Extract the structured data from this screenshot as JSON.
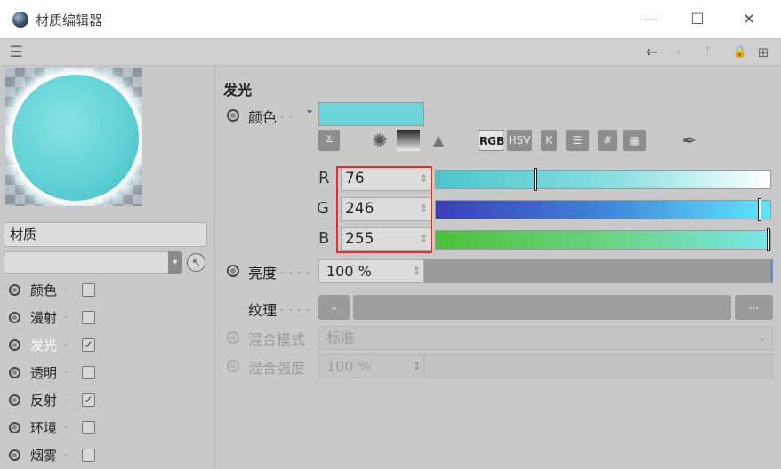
{
  "window": {
    "title": "材质编辑器",
    "controls": {
      "minimize": "—",
      "maximize": "☐",
      "close": "✕"
    }
  },
  "toolbar": {
    "menu_icon": "☰",
    "back_icon": "←",
    "forward_icon": "→",
    "up_icon": "↑",
    "lock_icon": "🔒",
    "new_icon": "⊞"
  },
  "left": {
    "material_name": "材质",
    "channels": [
      {
        "label": "颜色",
        "checked": false
      },
      {
        "label": "漫射",
        "checked": false
      },
      {
        "label": "发光",
        "checked": true
      },
      {
        "label": "透明",
        "checked": false
      },
      {
        "label": "反射",
        "checked": true
      },
      {
        "label": "环境",
        "checked": false
      },
      {
        "label": "烟雾",
        "checked": false
      }
    ]
  },
  "main": {
    "section_title": "发光",
    "color_label": "颜色",
    "color_value": "#6fd5d9",
    "picker_modes": [
      "RGB",
      "HSV",
      "K"
    ],
    "rgb": {
      "r_label": "R",
      "r_value": "76",
      "g_label": "G",
      "g_value": "246",
      "b_label": "B",
      "b_value": "255"
    },
    "brightness_label": "亮度",
    "brightness_value": "100 %",
    "texture_label": "纹理",
    "texture_more": "...",
    "blend_mode_label": "混合模式",
    "blend_mode_value": "标准",
    "blend_strength_label": "混合强度",
    "blend_strength_value": "100 %"
  },
  "colors": {
    "highlight_box": "#e03030",
    "sphere": "#6fd5d9"
  }
}
